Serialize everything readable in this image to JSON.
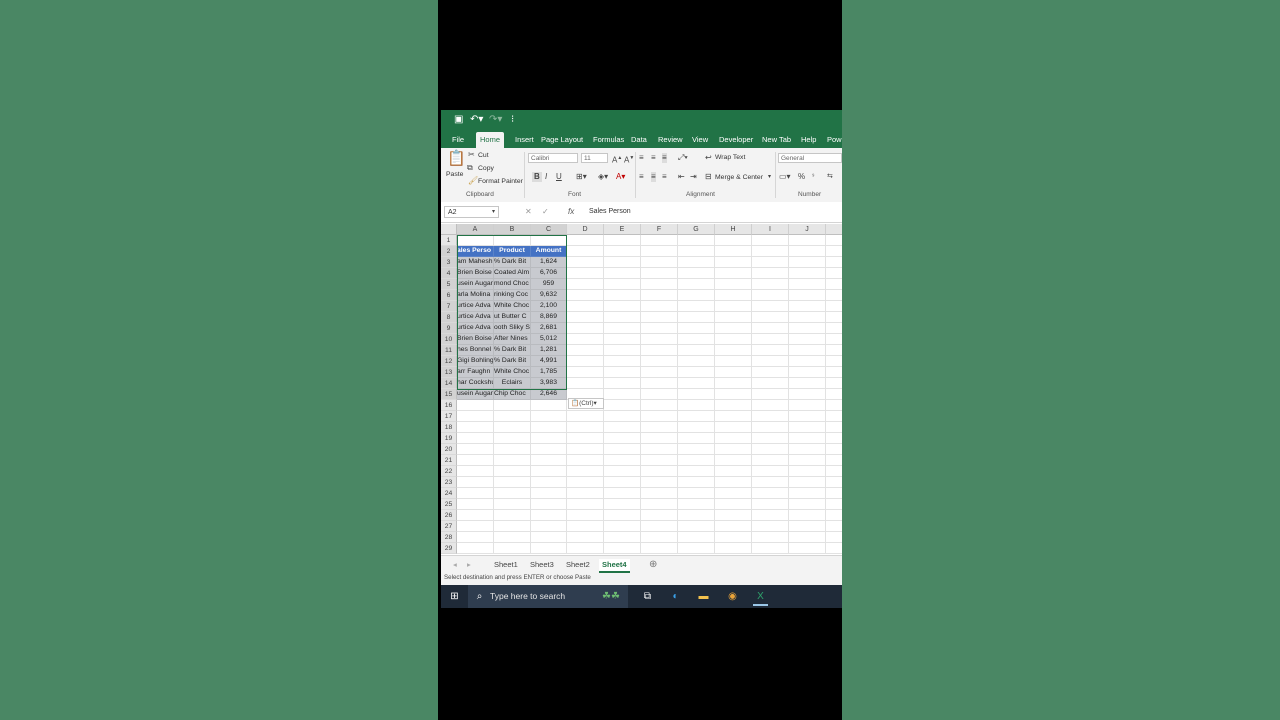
{
  "quick_access": {
    "save_icon": "save-icon",
    "undo_icon": "undo-icon",
    "redo_icon": "redo-icon"
  },
  "tabs": [
    "File",
    "Home",
    "Insert",
    "Page Layout",
    "Formulas",
    "Data",
    "Review",
    "View",
    "Developer",
    "New Tab",
    "Help",
    "Powe"
  ],
  "active_tab": "Home",
  "ribbon": {
    "paste_label": "Paste",
    "cut_label": "Cut",
    "copy_label": "Copy",
    "format_painter_label": "Format Painter",
    "clipboard_group": "Clipboard",
    "font_name": "Calibri",
    "font_size": "11",
    "bold": "B",
    "italic": "I",
    "underline": "U",
    "font_group": "Font",
    "wrap_text_label": "Wrap Text",
    "merge_center_label": "Merge & Center",
    "alignment_group": "Alignment",
    "number_format": "General",
    "percent": "%",
    "number_group": "Number"
  },
  "formula_bar": {
    "name_box": "A2",
    "fx": "fx",
    "content": "Sales Person"
  },
  "columns": [
    "A",
    "B",
    "C",
    "D",
    "E",
    "F",
    "G",
    "H",
    "I",
    "J",
    "K"
  ],
  "rows": [
    "1",
    "2",
    "3",
    "4",
    "5",
    "6",
    "7",
    "8",
    "9",
    "10",
    "11",
    "12",
    "13",
    "14",
    "15",
    "16",
    "17",
    "18",
    "19",
    "20",
    "21",
    "22",
    "23",
    "24",
    "25",
    "26",
    "27",
    "28",
    "29"
  ],
  "table": {
    "headers": [
      "Sales Person",
      "Product",
      "Amount"
    ],
    "header_display": [
      "ales Perso",
      "Product",
      "Amount"
    ],
    "rows": [
      [
        "am Mahesh",
        "% Dark Bit",
        "1,624"
      ],
      [
        "Brien Boise",
        "Coated Alm",
        "6,706"
      ],
      [
        "usein Augar",
        "mond Choc",
        "959"
      ],
      [
        "arla Molina",
        "rinking Coc",
        "9,632"
      ],
      [
        "urtice Adva",
        "White Choc",
        "2,100"
      ],
      [
        "urtice Adva",
        "ut Butter C",
        "8,869"
      ],
      [
        "urtice Adva",
        "ooth Sliky S",
        "2,681"
      ],
      [
        "Brien Boise",
        "After Nines",
        "5,012"
      ],
      [
        "hes Bonnel",
        "% Dark Bit",
        "1,281"
      ],
      [
        "Gigi Bohling",
        "% Dark Bit",
        "4,991"
      ],
      [
        "arr Faughn",
        "White Choc",
        "1,785"
      ],
      [
        "har Cockshu",
        "Eclairs",
        "3,983"
      ],
      [
        "usein Augar",
        "Chip Choc",
        "2,646"
      ]
    ]
  },
  "paste_options_label": "(Ctrl)",
  "sheets": [
    "Sheet1",
    "Sheet3",
    "Sheet2",
    "Sheet4"
  ],
  "active_sheet": "Sheet4",
  "status_text": "Select destination and press ENTER or choose Paste",
  "taskbar": {
    "search_placeholder": "Type here to search"
  },
  "colors": {
    "excel_green": "#217346",
    "table_header": "#4472c4",
    "selection": "#c8cacf"
  }
}
